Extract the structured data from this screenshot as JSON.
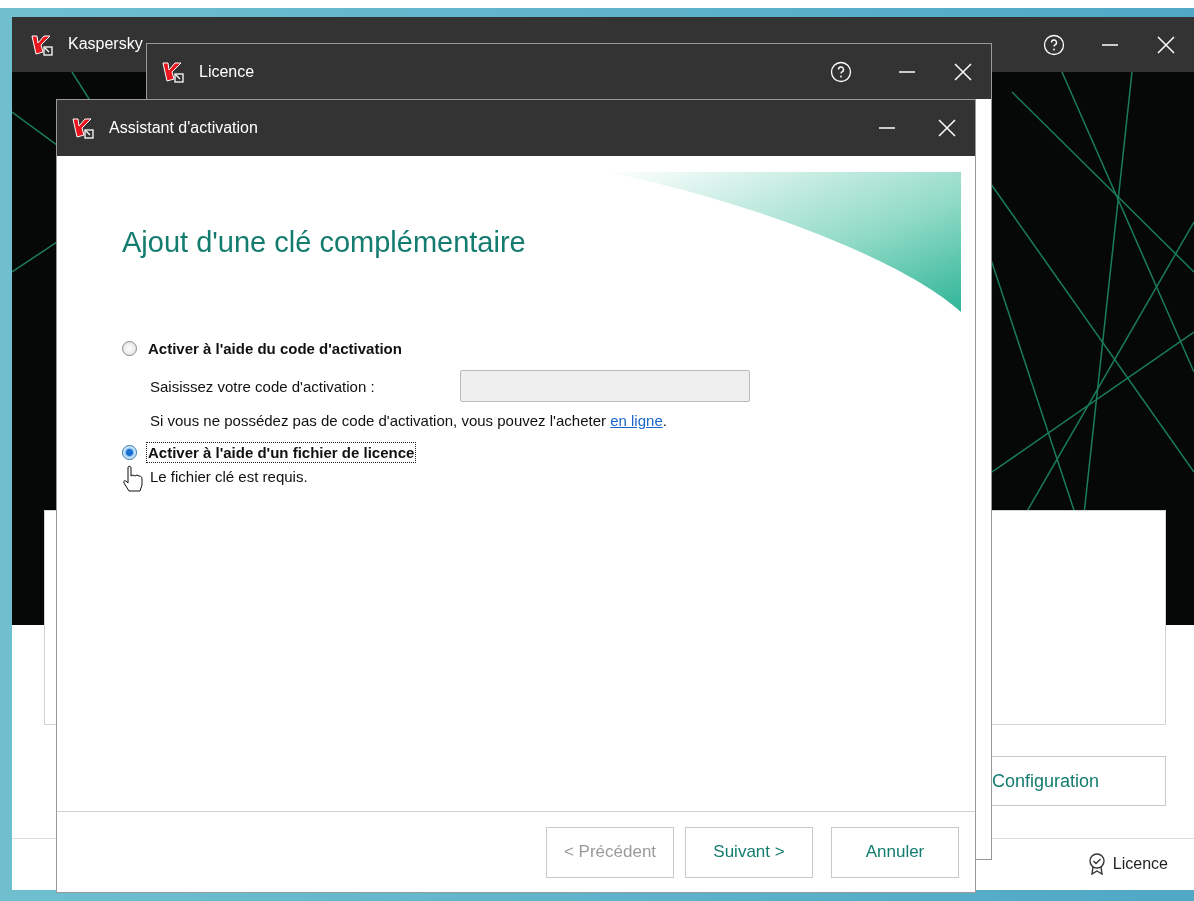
{
  "main_window": {
    "title": "Kaspersky",
    "configuration_button": "Configuration",
    "status_link": "Licence"
  },
  "licence_window": {
    "title": "Licence"
  },
  "wizard": {
    "title": "Assistant d'activation",
    "heading": "Ajout d'une clé complémentaire",
    "options": [
      {
        "kind": "code",
        "label": "Activer à l'aide du code d'activation",
        "selected": false,
        "field": {
          "label": "Saisissez votre code d'activation :",
          "disabled": true
        },
        "note": "Si vous ne possédez pas de code d'activation, vous pouvez l'acheter",
        "link": "en ligne",
        "note_end": "."
      },
      {
        "kind": "file",
        "label": "Activer à l'aide d'un fichier de licence",
        "selected": true,
        "note": "Le fichier clé est requis."
      }
    ],
    "buttons": [
      {
        "label": "< Précédent",
        "disabled": true
      },
      {
        "label": "Suivant >",
        "disabled": false
      },
      {
        "label": "Annuler",
        "disabled": false
      }
    ]
  }
}
